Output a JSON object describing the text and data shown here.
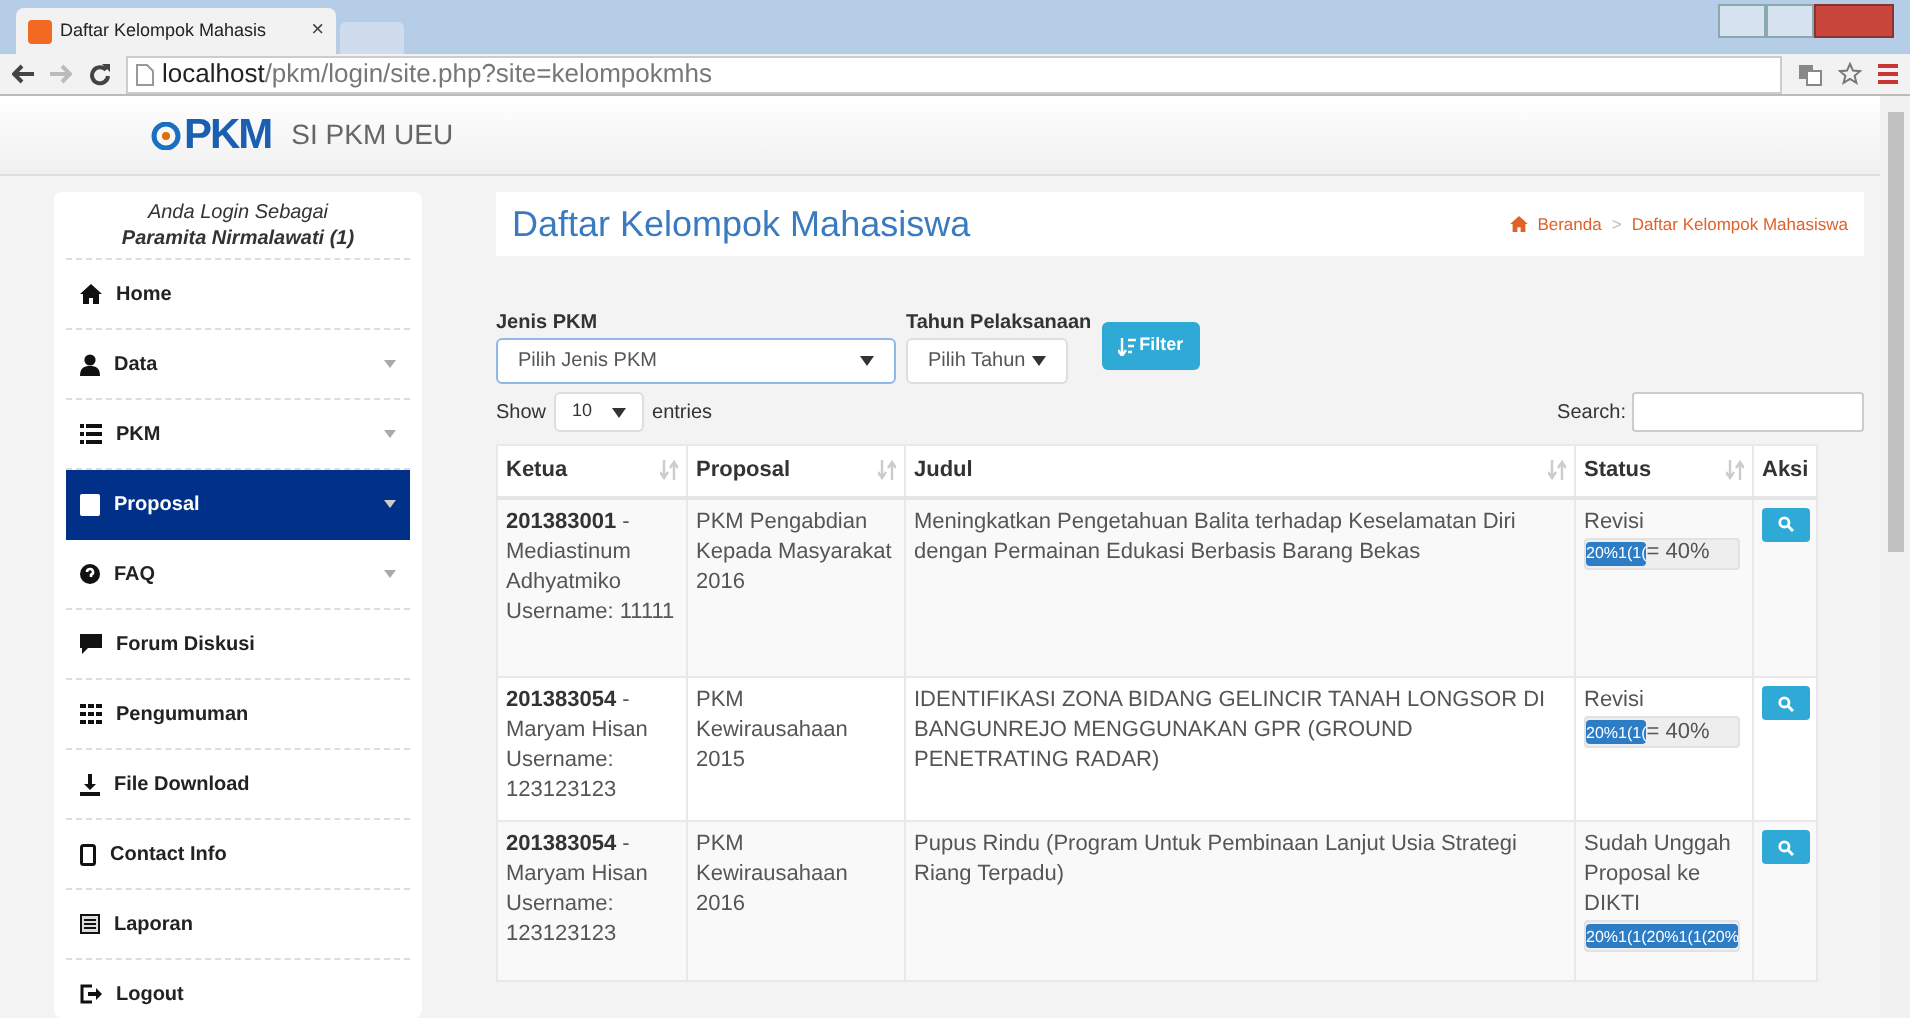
{
  "browser": {
    "tab_title": "Daftar Kelompok Mahasis",
    "tab_close": "×",
    "url_host": "localhost",
    "url_path": "/pkm/login/site.php?site=kelompokmhs"
  },
  "header": {
    "logo_text": "PKM",
    "site_name": "SI PKM UEU"
  },
  "sidebar": {
    "login_label": "Anda Login Sebagai",
    "user": "Paramita Nirmalawati (1)",
    "items": [
      {
        "label": "Home",
        "kind": "link",
        "selected": false
      },
      {
        "label": "Data",
        "kind": "dropdown",
        "selected": false
      },
      {
        "label": "PKM",
        "kind": "dropdown",
        "selected": false
      },
      {
        "label": "Proposal",
        "kind": "dropdown",
        "selected": true
      },
      {
        "label": "FAQ",
        "kind": "dropdown",
        "selected": false
      },
      {
        "label": "Forum Diskusi",
        "kind": "link",
        "selected": false
      },
      {
        "label": "Pengumuman",
        "kind": "link",
        "selected": false
      },
      {
        "label": "File Download",
        "kind": "link",
        "selected": false
      },
      {
        "label": "Contact Info",
        "kind": "link",
        "selected": false
      },
      {
        "label": "Laporan",
        "kind": "link",
        "selected": false
      },
      {
        "label": "Logout",
        "kind": "link",
        "selected": false
      }
    ]
  },
  "page": {
    "title": "Daftar Kelompok Mahasiswa",
    "breadcrumb": [
      "Beranda",
      "Daftar Kelompok Mahasiswa"
    ],
    "breadcrumb_sep": ">"
  },
  "filters": {
    "jenis_label": "Jenis PKM",
    "jenis_value": "Pilih Jenis PKM",
    "tahun_label": "Tahun Pelaksanaan",
    "tahun_value": "Pilih Tahun",
    "button": "Filter"
  },
  "table_controls": {
    "show": "Show",
    "entries_value": "10",
    "entries": "entries",
    "search": "Search:"
  },
  "table": {
    "columns": [
      "Ketua",
      "Proposal",
      "Judul",
      "Status",
      "Aksi"
    ],
    "rows": [
      {
        "ketua": "**201383001** - Mediastinum Adhyatmiko Username: 11111",
        "proposal": "PKM Pengabdian Kepada Masyarakat 2016",
        "judul": "Meningkatkan Pengetahuan Balita terhadap Keselamatan Diri dengan Permainan Edukasi Berbasis Barang Bekas",
        "status": "Revisi",
        "level": 0.4,
        "bar_text": "20%1(1(",
        "reading": "= 40%"
      },
      {
        "ketua": "**201383054** - Maryam Hisan Username: 123123123",
        "proposal": "PKM Kewirausahaan 2015",
        "judul": "IDENTIFIKASI ZONA BIDANG GELINCIR TANAH LONGSOR DI BANGUNREJO MENGGUNAKAN GPR (GROUND PENETRATING RADAR)",
        "status": "Revisi",
        "level": 0.4,
        "bar_text": "20%1(1(",
        "reading": "= 40%"
      },
      {
        "ketua": "**201383054** - Maryam Hisan Username: 123123123",
        "proposal": "PKM Kewirausahaan 2016",
        "judul": "Pupus Rindu (Program Untuk Pembinaan Lanjut Usia Strategi Riang Terpadu)",
        "status": "Sudah Unggah Proposal ke DIKTI",
        "level": 1,
        "bar_text": "20%1(1(20%1(1(20%",
        "reading": ""
      }
    ]
  }
}
